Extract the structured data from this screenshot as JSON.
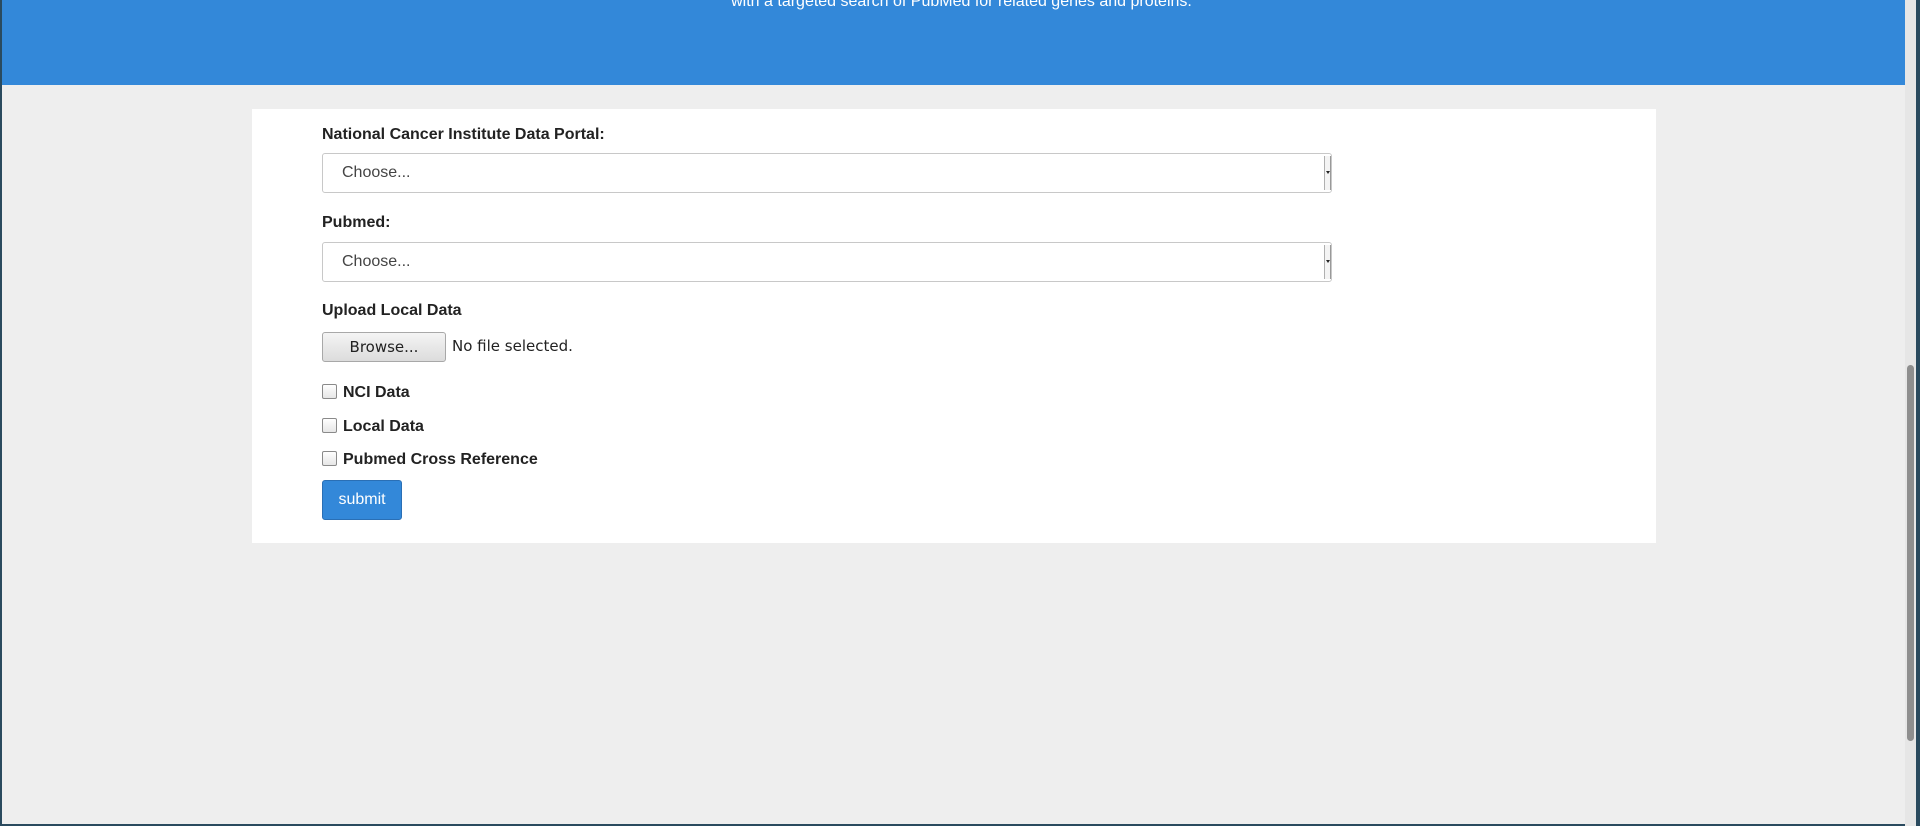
{
  "hero": {
    "text": "with a targeted search of PubMed for related genes and proteins."
  },
  "form": {
    "nci_portal": {
      "label": "National Cancer Institute Data Portal:",
      "selected": "Choose..."
    },
    "pubmed": {
      "label": "Pubmed:",
      "selected": "Choose..."
    },
    "upload": {
      "label": "Upload Local Data",
      "browse_label": "Browse...",
      "status": "No file selected."
    },
    "checkboxes": [
      {
        "label": "NCI Data"
      },
      {
        "label": "Local Data"
      },
      {
        "label": "Pubmed Cross Reference"
      }
    ],
    "submit_label": "submit"
  },
  "colors": {
    "accent": "#3388d9",
    "background": "#eeeeee",
    "panel": "#ffffff"
  }
}
